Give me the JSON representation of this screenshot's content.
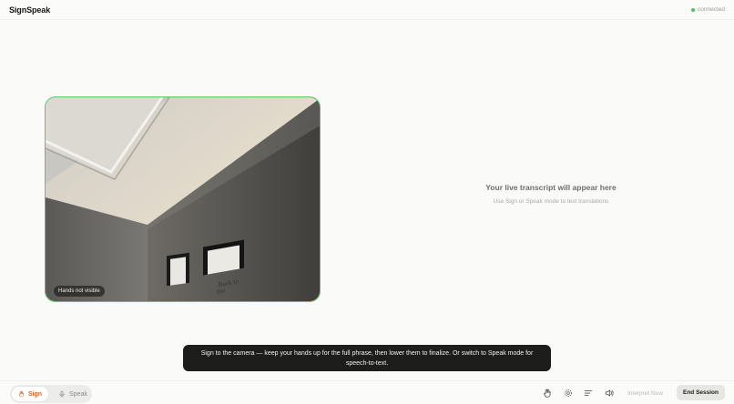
{
  "header": {
    "brand": "SignSpeak",
    "status": "connected",
    "status_color": "#4cc35a"
  },
  "camera": {
    "badge": "Hands not visible",
    "border_color": "#5cc76a"
  },
  "transcript": {
    "title": "Your live transcript will appear here",
    "subtitle": "Use Sign or Speak mode to test translations"
  },
  "toast": {
    "message": "Sign to the camera — keep your hands up for the full phrase, then lower them to finalize. Or switch to Speak mode for speech-to-text."
  },
  "footer": {
    "modes": [
      {
        "label": "Sign",
        "icon": "hand-icon",
        "active": true
      },
      {
        "label": "Speak",
        "icon": "microphone-icon",
        "active": false
      }
    ],
    "tools": [
      "hand-icon",
      "gear-icon",
      "text-lines-icon",
      "speaker-icon"
    ],
    "interpret_label": "Interpret Now",
    "end_label": "End Session",
    "accent_color": "#d2692c"
  }
}
